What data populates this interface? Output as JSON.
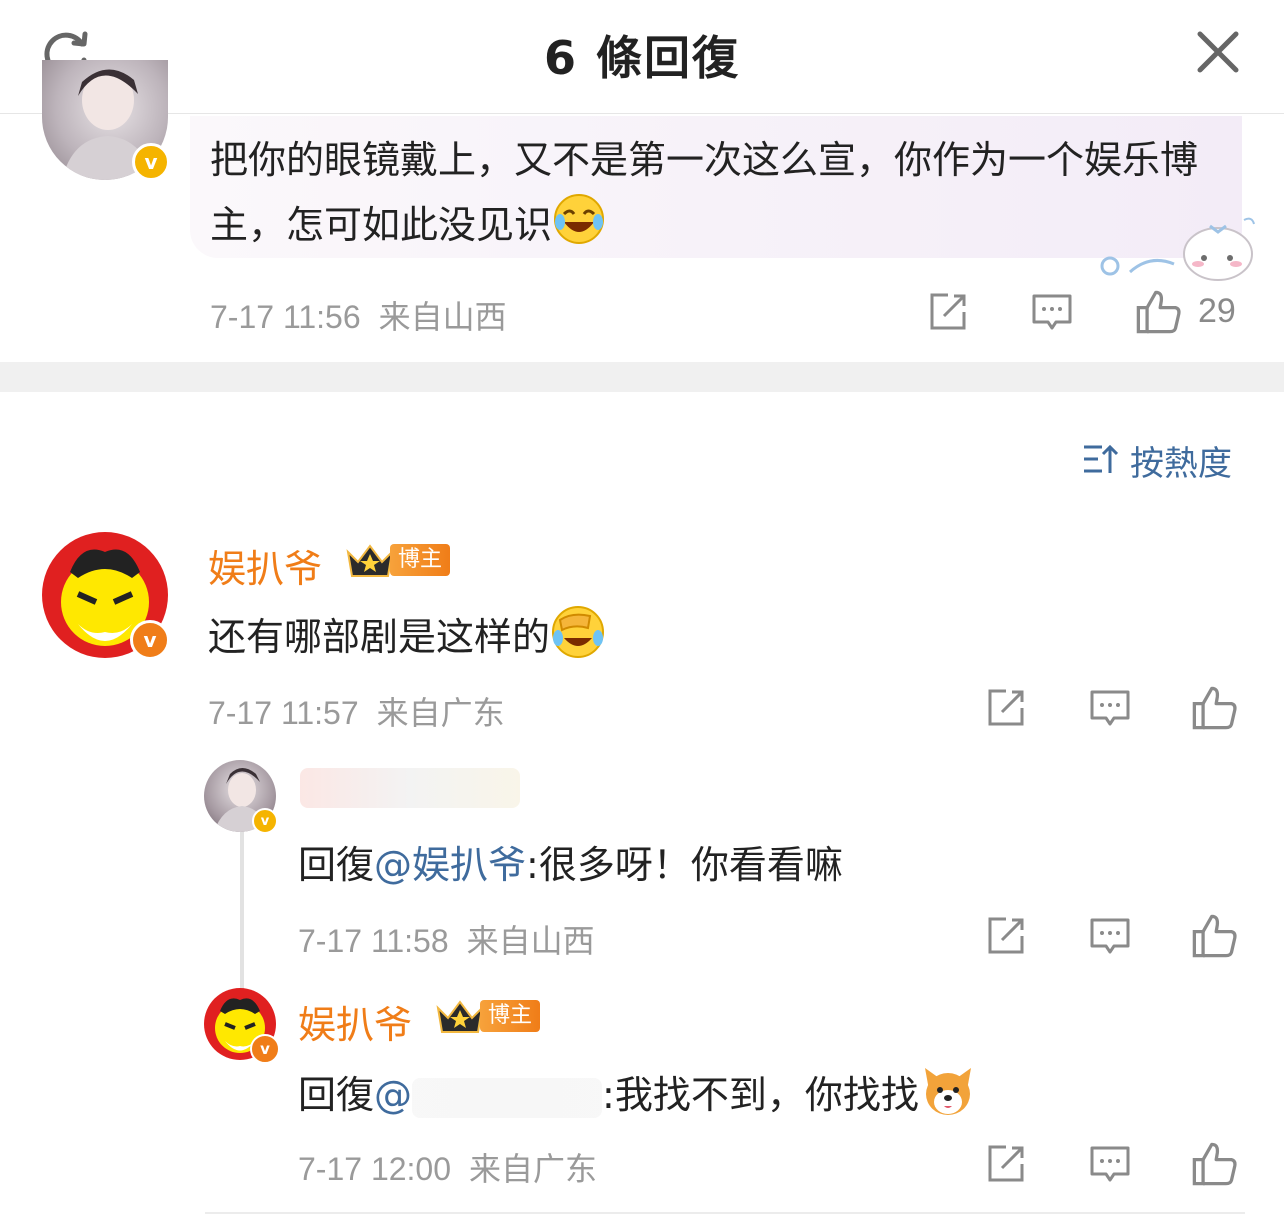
{
  "header": {
    "title": "6 條回復"
  },
  "top_comment": {
    "text": "把你的眼镜戴上，又不是第一次这么宣，你作为一个娱乐博主，怎可如此没见识",
    "time": "7-17 11:56",
    "location": "来自山西",
    "likes": "29"
  },
  "sort": {
    "label": "按熱度"
  },
  "comments": [
    {
      "username": "娱扒爷",
      "badge": "博主",
      "text": "还有哪部剧是这样的",
      "time": "7-17 11:57",
      "location": "来自广东"
    },
    {
      "username": "",
      "reply_prefix": "回復",
      "reply_at": "@娱扒爷",
      "text": ":很多呀！你看看嘛",
      "time": "7-17 11:58",
      "location": "来自山西"
    },
    {
      "username": "娱扒爷",
      "badge": "博主",
      "reply_prefix": "回復",
      "reply_at": "@",
      "text": ":我找不到，你找找",
      "time": "7-17 12:00",
      "location": "来自广东"
    }
  ],
  "colors": {
    "username": "#f07d18",
    "link": "#3f6b9d",
    "meta": "#9a9a9a",
    "verified_gold": "#f5b400",
    "verified_orange": "#f07d18"
  },
  "icons": [
    "refresh-icon",
    "close-icon",
    "share-icon",
    "comment-icon",
    "like-icon",
    "sort-icon"
  ]
}
